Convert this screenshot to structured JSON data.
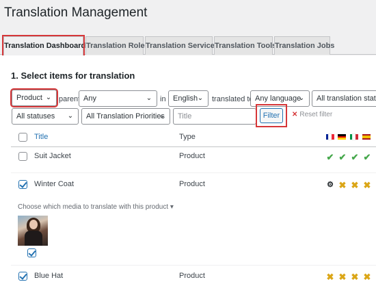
{
  "page_title": "Translation Management",
  "tabs": [
    {
      "label": "Translation Dashboard",
      "active": true
    },
    {
      "label": "Translation Roles"
    },
    {
      "label": "Translation Services"
    },
    {
      "label": "Translation Tools"
    },
    {
      "label": "Translation Jobs"
    }
  ],
  "section_title": "1. Select items for translation",
  "filters": {
    "type_select": "Product",
    "parent_label": "parent",
    "parent_select": "Any",
    "in_label": "in",
    "language_select": "English",
    "translated_to_label": "translated to",
    "target_language_select": "Any language",
    "translation_status_select": "All translation status",
    "statuses_select": "All statuses",
    "priorities_select": "All Translation Priorities",
    "title_placeholder": "Title",
    "filter_button": "Filter",
    "reset_label": "Reset filter"
  },
  "table": {
    "header_title": "Title",
    "header_type": "Type",
    "flags": [
      {
        "code": "fr",
        "colors": [
          "#002395",
          "#ffffff",
          "#ed2939"
        ],
        "orientation": "vertical"
      },
      {
        "code": "de",
        "colors": [
          "#000000",
          "#dd0000",
          "#ffce00"
        ],
        "orientation": "horizontal"
      },
      {
        "code": "it",
        "colors": [
          "#009246",
          "#ffffff",
          "#ce2b37"
        ],
        "orientation": "vertical"
      },
      {
        "code": "es",
        "colors": [
          "#aa151b",
          "#f1bf00",
          "#aa151b"
        ],
        "orientation": "horizontal"
      }
    ],
    "rows": [
      {
        "title": "Suit Jacket",
        "type": "Product",
        "checked": false,
        "statuses": [
          "check-icon",
          "check-icon",
          "check-icon",
          "check-icon"
        ]
      },
      {
        "title": "Winter Coat",
        "type": "Product",
        "checked": true,
        "statuses": [
          "gear-icon",
          "cross-icon",
          "cross-icon",
          "cross-icon"
        ]
      },
      {
        "title": "Blue Hat",
        "type": "Product",
        "checked": true,
        "statuses": [
          "cross-icon",
          "cross-icon",
          "cross-icon",
          "cross-icon"
        ]
      }
    ],
    "media_label": "Choose which media to translate with this product ▾",
    "media_checked": true
  },
  "colors": {
    "highlight": "#d63638",
    "link": "#2271b1",
    "done": "#46a84c",
    "untranslated": "#dba617"
  }
}
